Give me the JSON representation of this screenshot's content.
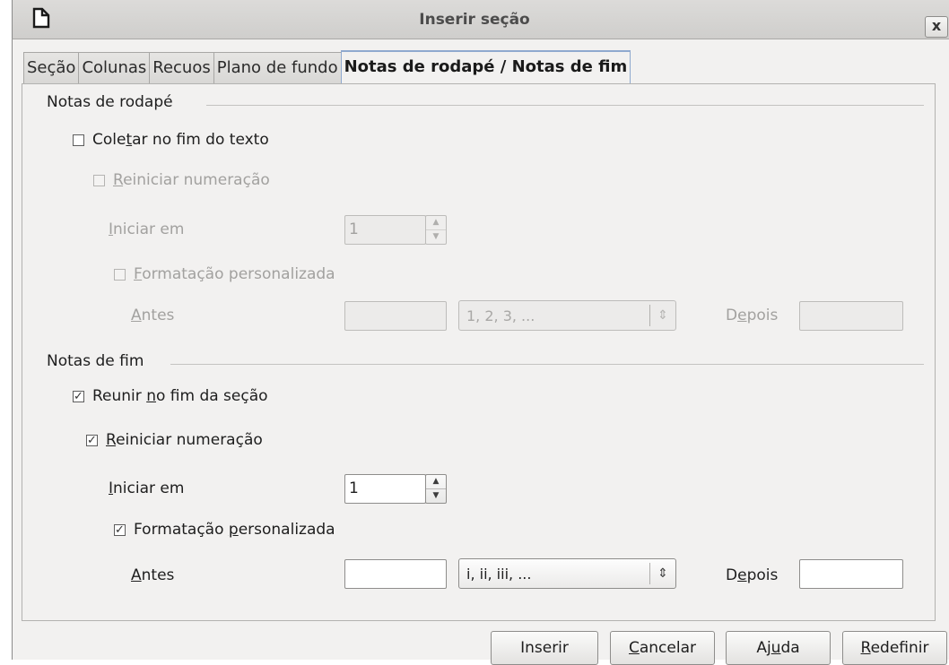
{
  "window": {
    "title": "Inserir seção",
    "close_label": "x"
  },
  "tabs": [
    {
      "label": "Seção",
      "active": false
    },
    {
      "label": "Colunas",
      "active": false
    },
    {
      "label": "Recuos",
      "active": false
    },
    {
      "label": "Plano de fundo",
      "active": false
    },
    {
      "label": "Notas de rodapé / Notas de fim",
      "active": true
    }
  ],
  "footnotes": {
    "title": "Notas de rodapé",
    "collect": {
      "pre": "Cole",
      "ul": "t",
      "post": "ar no fim do texto",
      "checked": false,
      "enabled": true
    },
    "restart": {
      "pre": "",
      "ul": "R",
      "post": "einiciar numeração",
      "checked": false,
      "enabled": false
    },
    "start_at": {
      "pre": "",
      "ul": "I",
      "post": "niciar em",
      "value": "1",
      "enabled": false
    },
    "custom_format": {
      "pre": "",
      "ul": "F",
      "post": "ormatação personalizada",
      "checked": false,
      "enabled": false
    },
    "before": {
      "pre": "",
      "ul": "A",
      "post": "ntes",
      "value": "",
      "enabled": false
    },
    "format_select": {
      "value": "1, 2, 3, ...",
      "enabled": false
    },
    "after": {
      "pre": "D",
      "ul": "e",
      "post": "pois",
      "value": "",
      "enabled": false
    }
  },
  "endnotes": {
    "title": "Notas de fim",
    "collect": {
      "pre": "Reunir ",
      "ul": "n",
      "post": "o fim da seção",
      "checked": true,
      "enabled": true
    },
    "restart": {
      "pre": "",
      "ul": "R",
      "post": "einiciar numeração",
      "checked": true,
      "enabled": true
    },
    "start_at": {
      "pre": "",
      "ul": "I",
      "post": "niciar em",
      "value": "1",
      "enabled": true
    },
    "custom_format": {
      "pre": "Formatação ",
      "ul": "p",
      "post": "ersonalizada",
      "checked": true,
      "enabled": true
    },
    "before": {
      "pre": "",
      "ul": "A",
      "post": "ntes",
      "value": "",
      "enabled": true
    },
    "format_select": {
      "value": "i, ii, iii, ...",
      "enabled": true
    },
    "after": {
      "pre": "D",
      "ul": "e",
      "post": "pois",
      "value": "",
      "enabled": true
    }
  },
  "buttons": {
    "insert": {
      "pre": "Inserir",
      "ul": "",
      "post": ""
    },
    "cancel": {
      "pre": "",
      "ul": "C",
      "post": "ancelar"
    },
    "help": {
      "pre": "Aj",
      "ul": "u",
      "post": "da"
    },
    "reset": {
      "pre": "",
      "ul": "R",
      "post": "edefinir"
    }
  },
  "glyphs": {
    "check": "✓",
    "spin_up": "▲",
    "spin_down": "▼",
    "select_arrow": "⇕"
  },
  "colors": {
    "active_tab_border": "#8fa9cf",
    "disabled_text": "#a2a19f"
  }
}
